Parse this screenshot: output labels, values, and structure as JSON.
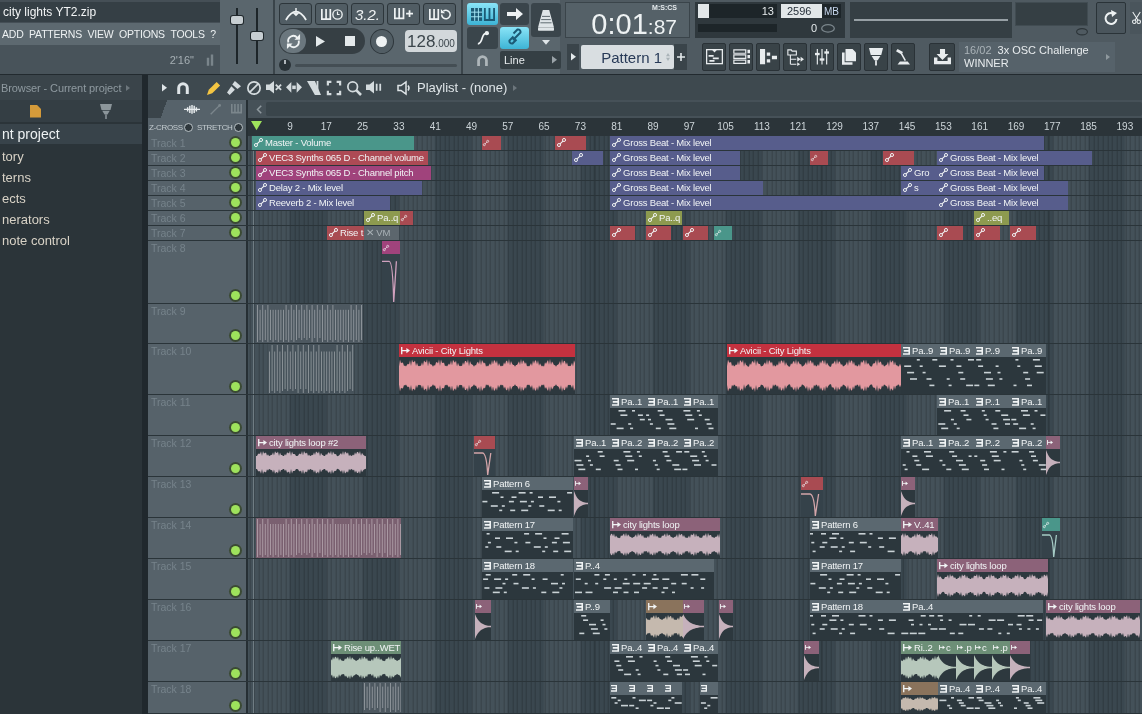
{
  "menu": {
    "title": "city lights YT2.zip",
    "items": [
      "ADD",
      "PATTERNS",
      "VIEW",
      "OPTIONS",
      "TOOLS",
      "?"
    ],
    "song_length": "2'16\""
  },
  "master": {
    "volume": {
      "level": 0.83
    },
    "pitch": {
      "level": 0.5
    }
  },
  "transport": {
    "snap_display": "3.2.",
    "tempo": "128",
    "tempo_fraction": ".000"
  },
  "modes": [
    {
      "on": true
    },
    {
      "on": false
    },
    {
      "on": false
    },
    {
      "on": true
    }
  ],
  "snap": {
    "value": "Line"
  },
  "clock": {
    "time": "0:01",
    "centiseconds": ":87",
    "format": "M:S:CS"
  },
  "meters": {
    "cpu": {
      "reading": "13",
      "level": 0.14
    },
    "memory": {
      "reading": "2596",
      "unit": "MB",
      "level": 0.68
    },
    "polyphony": {
      "reading": "0"
    }
  },
  "pattern_selector": {
    "value": "Pattern 1"
  },
  "news": {
    "date": "16/02",
    "headline": "3x OSC Challenge",
    "subline": "WINNER"
  },
  "browser": {
    "title": "Browser - Current project",
    "items": [
      {
        "label": "nt project",
        "kind": "header"
      },
      {
        "label": "tory",
        "kind": "item"
      },
      {
        "label": "terns",
        "kind": "item"
      },
      {
        "label": "ects",
        "kind": "item"
      },
      {
        "label": "nerators",
        "kind": "item"
      },
      {
        "label": "note control",
        "kind": "item"
      }
    ]
  },
  "playlist": {
    "title": "Playlist - (none)",
    "tools": [
      {
        "selected": true
      },
      {
        "selected": false
      },
      {
        "selected": false
      },
      {
        "selected": false
      },
      {
        "selected": false
      },
      {
        "selected": false
      },
      {
        "selected": false
      },
      {
        "selected": false
      },
      {
        "selected": false
      }
    ],
    "z_cross": {
      "label": "Z-CROSS",
      "checked": false
    },
    "stretch": {
      "label": "STRETCH",
      "checked": false
    },
    "ruler": [
      "9",
      "17",
      "25",
      "33",
      "41",
      "49",
      "57",
      "65",
      "73",
      "81",
      "89",
      "97",
      "105",
      "113",
      "121",
      "129",
      "137",
      "145",
      "153",
      "161",
      "169",
      "177",
      "185",
      "193"
    ],
    "tracks": [
      {
        "name": "Track 1",
        "on": true,
        "clips": [
          {
            "label": "Master - Volume",
            "kind": "automation",
            "color": "#4a968a"
          },
          {
            "kind": "automation",
            "color": "#a94b52"
          },
          {
            "kind": "automation",
            "color": "#a94b52"
          },
          {
            "label": "Gross Beat - Mix level",
            "kind": "automation",
            "color": "#575d8c"
          }
        ]
      },
      {
        "name": "Track 2",
        "on": true,
        "clips": [
          {
            "label": "VEC3 Synths 065 D - Channel volume",
            "kind": "automation",
            "color": "#ad4a55"
          },
          {
            "kind": "automation",
            "color": "#575d8c"
          },
          {
            "label": "Gross Beat - Mix level",
            "kind": "automation",
            "color": "#575d8c"
          },
          {
            "kind": "automation",
            "color": "#a94b52"
          },
          {
            "kind": "automation",
            "color": "#a94b52"
          },
          {
            "label": "Gross Beat - Mix level",
            "kind": "automation",
            "color": "#575d8c"
          }
        ]
      },
      {
        "name": "Track 3",
        "on": true,
        "clips": [
          {
            "label": "VEC3 Synths 065 D - Channel pitch",
            "kind": "automation",
            "color": "#a0437c"
          },
          {
            "label": "Gross Beat - Mix level",
            "kind": "automation",
            "color": "#575d8c"
          },
          {
            "label": "Gro",
            "kind": "automation",
            "color": "#575d8c"
          },
          {
            "label": "Gross Beat - Mix level",
            "kind": "automation",
            "color": "#575d8c"
          }
        ]
      },
      {
        "name": "Track 4",
        "on": true,
        "clips": [
          {
            "label": "Delay 2 - Mix level",
            "kind": "automation",
            "color": "#575d8c"
          },
          {
            "label": "Gross Beat - Mix level",
            "kind": "automation",
            "color": "#575d8c"
          },
          {
            "label": "s",
            "kind": "automation",
            "color": "#575d8c"
          },
          {
            "label": "Gross Beat - Mix level",
            "kind": "automation",
            "color": "#575d8c"
          }
        ]
      },
      {
        "name": "Track 5",
        "on": true,
        "clips": [
          {
            "label": "Reeverb 2 - Mix level",
            "kind": "automation",
            "color": "#575d8c"
          },
          {
            "label": "Gross Beat - Mix level",
            "kind": "automation",
            "color": "#575d8c"
          },
          {
            "label": "Gross Beat - Mix level",
            "kind": "automation",
            "color": "#575d8c"
          }
        ]
      },
      {
        "name": "Track 6",
        "on": true,
        "clips": [
          {
            "label": "Pa..q",
            "kind": "automation",
            "color": "#8d9a4f"
          },
          {
            "kind": "automation",
            "color": "#a94b52"
          },
          {
            "label": "Pa..q",
            "kind": "automation",
            "color": "#8d9a4f"
          },
          {
            "label": "..eq",
            "kind": "automation",
            "color": "#8d9a4f"
          }
        ]
      },
      {
        "name": "Track 7",
        "on": true,
        "clips": [
          {
            "label": "Rise t",
            "kind": "automation",
            "color": "#a94b52"
          },
          {
            "label": "✕ VM",
            "kind": "plain",
            "color": "#5c666d"
          },
          {
            "kind": "automation",
            "color": "#a94b52"
          },
          {
            "kind": "automation",
            "color": "#a94b52"
          },
          {
            "kind": "automation",
            "color": "#a94b52"
          },
          {
            "kind": "automation",
            "color": "#4a968a"
          },
          {
            "kind": "automation",
            "color": "#a94b52"
          },
          {
            "kind": "automation",
            "color": "#a94b52"
          },
          {
            "kind": "automation",
            "color": "#a94b52"
          }
        ]
      },
      {
        "name": "Track 8",
        "on": true,
        "clips": [
          {
            "kind": "automation",
            "color": "#a0437c"
          }
        ]
      },
      {
        "name": "Track 9",
        "on": true,
        "clips": [
          {
            "kind": "strip",
            "color": "#4d5860"
          }
        ]
      },
      {
        "name": "Track 10",
        "on": true,
        "clips": [
          {
            "kind": "strip",
            "color": "#46525a"
          },
          {
            "label": "Avicii - City Lights",
            "kind": "audio",
            "color": "#c4313f"
          },
          {
            "label": "Avicii - City Lights",
            "kind": "audio",
            "color": "#c4313f"
          },
          {
            "label": "Pa..9",
            "kind": "pattern",
            "color": "#5b6870"
          },
          {
            "label": "Pa..9",
            "kind": "pattern",
            "color": "#5b6870"
          },
          {
            "label": "P..9",
            "kind": "pattern",
            "color": "#5b6870"
          },
          {
            "label": "Pa..9",
            "kind": "pattern",
            "color": "#5b6870"
          }
        ]
      },
      {
        "name": "Track 11",
        "on": true,
        "clips": [
          {
            "label": "Pa..1",
            "kind": "pattern",
            "color": "#5b6870"
          },
          {
            "label": "Pa..1",
            "kind": "pattern",
            "color": "#5b6870"
          },
          {
            "label": "Pa..1",
            "kind": "pattern",
            "color": "#5b6870"
          },
          {
            "label": "Pa..1",
            "kind": "pattern",
            "color": "#5b6870"
          },
          {
            "label": "P..1",
            "kind": "pattern",
            "color": "#5b6870"
          },
          {
            "label": "Pa..1",
            "kind": "pattern",
            "color": "#5b6870"
          }
        ]
      },
      {
        "name": "Track 12",
        "on": true,
        "clips": [
          {
            "label": "city lights loop #2",
            "kind": "audio",
            "color": "#8c6279"
          },
          {
            "kind": "automation",
            "color": "#a94b52"
          },
          {
            "label": "Pa..1",
            "kind": "pattern",
            "color": "#5b6870"
          },
          {
            "label": "Pa..2",
            "kind": "pattern",
            "color": "#5b6870"
          },
          {
            "label": "Pa..2",
            "kind": "pattern",
            "color": "#5b6870"
          },
          {
            "label": "Pa..2",
            "kind": "pattern",
            "color": "#5b6870"
          },
          {
            "label": "Pa..1",
            "kind": "pattern",
            "color": "#5b6870"
          },
          {
            "label": "Pa..2",
            "kind": "pattern",
            "color": "#5b6870"
          },
          {
            "label": "P..2",
            "kind": "pattern",
            "color": "#5b6870"
          },
          {
            "label": "Pa..2",
            "kind": "pattern",
            "color": "#5b6870"
          },
          {
            "kind": "audio",
            "color": "#8c6279"
          }
        ]
      },
      {
        "name": "Track 13",
        "on": true,
        "clips": [
          {
            "label": "Pattern 6",
            "kind": "pattern",
            "color": "#5b6870"
          },
          {
            "kind": "audio",
            "color": "#8c6279"
          },
          {
            "kind": "automation",
            "color": "#a94b52"
          },
          {
            "kind": "audio",
            "color": "#8c6279"
          }
        ]
      },
      {
        "name": "Track 14",
        "on": true,
        "clips": [
          {
            "kind": "strip",
            "color": "#7a6070"
          },
          {
            "label": "Pattern 17",
            "kind": "pattern",
            "color": "#5b6870"
          },
          {
            "label": "city lights loop",
            "kind": "audio",
            "color": "#8c6279"
          },
          {
            "label": "Pattern 6",
            "kind": "pattern",
            "color": "#5b6870"
          },
          {
            "label": "V..41",
            "kind": "audio",
            "color": "#8c6279"
          },
          {
            "kind": "automation",
            "color": "#4a968a"
          }
        ]
      },
      {
        "name": "Track 15",
        "on": true,
        "clips": [
          {
            "label": "Pattern 18",
            "kind": "pattern",
            "color": "#5b6870"
          },
          {
            "label": "P..4",
            "kind": "pattern",
            "color": "#5b6870"
          },
          {
            "label": "Pattern 17",
            "kind": "pattern",
            "color": "#5b6870"
          },
          {
            "label": "city lights loop",
            "kind": "audio",
            "color": "#8c6279"
          }
        ]
      },
      {
        "name": "Track 16",
        "on": true,
        "clips": [
          {
            "kind": "audio",
            "color": "#8c6279"
          },
          {
            "label": "P..9",
            "kind": "pattern",
            "color": "#5b6870"
          },
          {
            "kind": "audio",
            "color": "#8a735c"
          },
          {
            "kind": "audio",
            "color": "#8c6279"
          },
          {
            "kind": "audio",
            "color": "#8c6279"
          },
          {
            "label": "Pattern 18",
            "kind": "pattern",
            "color": "#5b6870"
          },
          {
            "label": "Pa..4",
            "kind": "pattern",
            "color": "#5b6870"
          },
          {
            "label": "city lights loop",
            "kind": "audio",
            "color": "#8c6279"
          }
        ]
      },
      {
        "name": "Track 17",
        "on": true,
        "clips": [
          {
            "label": "Rise up..WET",
            "kind": "audio",
            "color": "#6d8f77"
          },
          {
            "label": "Pa..4",
            "kind": "pattern",
            "color": "#5b6870"
          },
          {
            "label": "Pa..4",
            "kind": "pattern",
            "color": "#5b6870"
          },
          {
            "label": "Pa..4",
            "kind": "pattern",
            "color": "#5b6870"
          },
          {
            "kind": "audio",
            "color": "#8c6279"
          },
          {
            "label": "Ri..2",
            "kind": "audio",
            "color": "#6d8f77"
          },
          {
            "label": "c",
            "kind": "audio",
            "color": "#6d8f77"
          },
          {
            "label": ".p",
            "kind": "audio",
            "color": "#6d8f77"
          },
          {
            "label": "c",
            "kind": "audio",
            "color": "#6d8f77"
          },
          {
            "label": ".p",
            "kind": "audio",
            "color": "#6d8f77"
          },
          {
            "kind": "audio",
            "color": "#8c6279"
          }
        ]
      },
      {
        "name": "Track 18",
        "on": true,
        "clips": [
          {
            "kind": "strip",
            "color": "#4d5860"
          },
          {
            "kind": "pattern",
            "color": "#5b6870"
          },
          {
            "kind": "pattern",
            "color": "#5b6870"
          },
          {
            "kind": "pattern",
            "color": "#5b6870"
          },
          {
            "kind": "pattern",
            "color": "#5b6870"
          },
          {
            "kind": "pattern",
            "color": "#5b6870"
          },
          {
            "kind": "audio",
            "color": "#8a735c"
          },
          {
            "label": "Pa..4",
            "kind": "pattern",
            "color": "#5b6870"
          },
          {
            "label": "P..4",
            "kind": "pattern",
            "color": "#5b6870"
          },
          {
            "label": "Pa..4",
            "kind": "pattern",
            "color": "#5b6870"
          }
        ]
      }
    ]
  }
}
